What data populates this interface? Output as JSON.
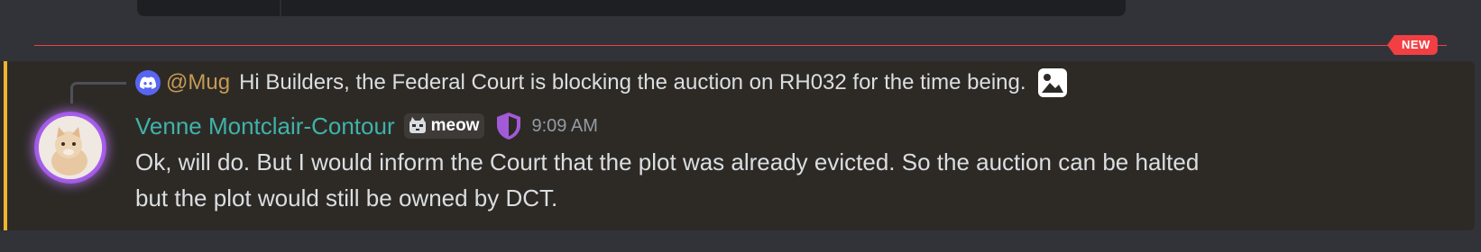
{
  "new_divider": {
    "badge_label": "NEW"
  },
  "reply": {
    "author": "@Mug",
    "text": "Hi Builders, the Federal Court is blocking the auction on RH032 for the time being.",
    "avatar_icon": "discord-logo-icon",
    "attachment_icon": "image-icon"
  },
  "message": {
    "author": "Venne Montclair-Contour",
    "clan_tag": "meow",
    "clan_icon": "cat-tag-icon",
    "badge_icon": "purple-shield-icon",
    "timestamp": "9:09 AM",
    "lines": [
      "Ok, will do. But I would inform the Court that the plot was already evicted. So the auction can be halted",
      "but the plot would still be owned by DCT."
    ]
  },
  "colors": {
    "background": "#313338",
    "highlight_background": "#2d2a26",
    "highlight_bar": "#f0b232",
    "new_divider": "#f23f43",
    "username": "#3fb3aa",
    "reply_author": "#c59a53",
    "text": "#dbdee1",
    "timestamp": "#949ba4"
  }
}
